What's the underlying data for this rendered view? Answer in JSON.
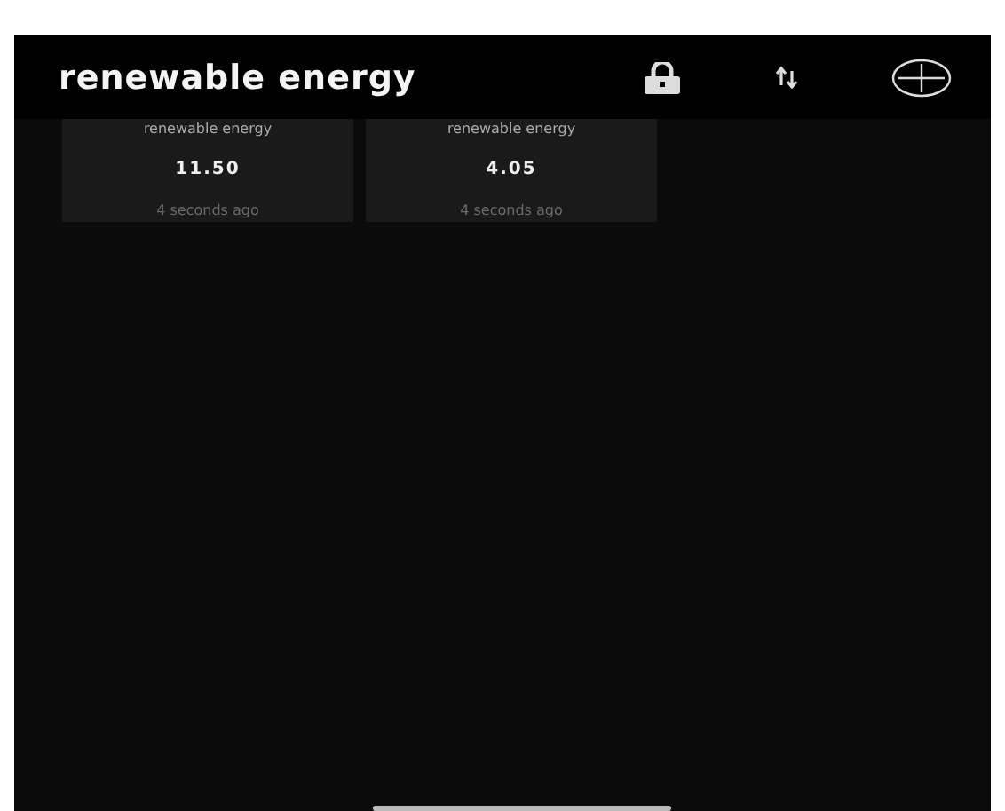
{
  "header": {
    "title": "renewable energy"
  },
  "cards": [
    {
      "label": "renewable energy",
      "value": "11.50",
      "updated": "4 seconds ago"
    },
    {
      "label": "renewable energy",
      "value": "4.05",
      "updated": "4 seconds ago"
    }
  ]
}
